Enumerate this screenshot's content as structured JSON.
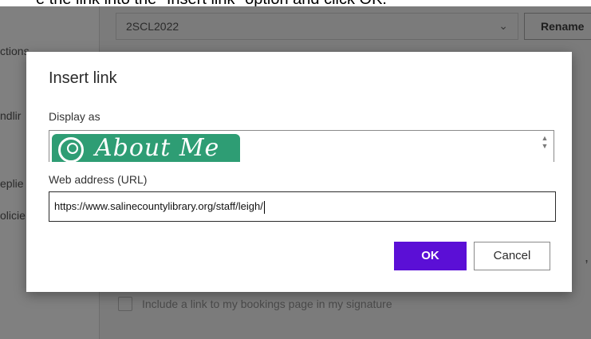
{
  "instruction_caption": "e the link into the \"Insert link\" option and click OK.",
  "background": {
    "sidebar_fragments": [
      "ctions",
      "ndlir",
      "eplie",
      "olicie"
    ],
    "signature_select": {
      "value": "2SCL2022"
    },
    "rename_button_label": "Rename",
    "bookings_checkbox_label": "Include a link to my bookings page in my signature",
    "trailing_comma": ","
  },
  "dialog": {
    "title": "Insert link",
    "display_as_label": "Display as",
    "display_as_image_text": "About Me",
    "url_label": "Web address (URL)",
    "url_value": "https://www.salinecountylibrary.org/staff/leigh/",
    "ok_label": "OK",
    "cancel_label": "Cancel"
  },
  "colors": {
    "primary_button": "#5b0fd6",
    "badge_green": "#2e9d74",
    "overlay": "#7b7b7b"
  },
  "icons": {
    "select_chevron": "chevron-down-icon",
    "badge_person": "person-circle-icon",
    "scroll_up": "scroll-up-icon",
    "scroll_down": "scroll-down-icon"
  }
}
